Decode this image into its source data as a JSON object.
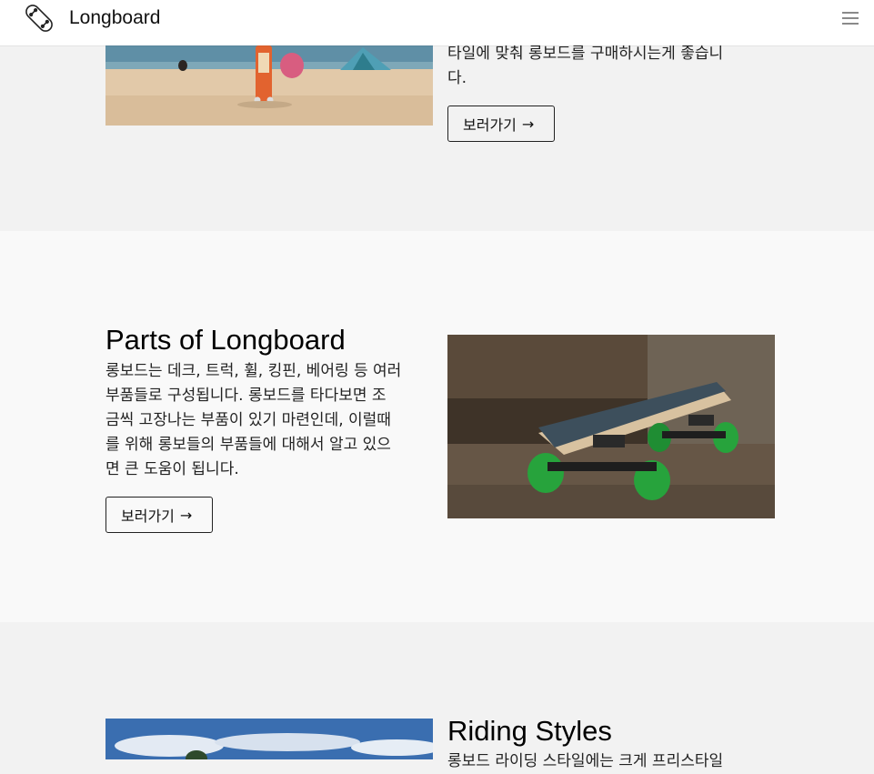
{
  "navbar": {
    "brand": "Longboard",
    "brand_icon": "skateboard-icon",
    "menu_icon": "hamburger-menu-icon"
  },
  "sections": [
    {
      "id": "buying",
      "text": "타일에 맞춰 롱보드를 구매하시는게 좋습니\n다.",
      "button_label": "보러가기",
      "button_arrow": "→"
    },
    {
      "id": "parts",
      "title": "Parts of Longboard",
      "text": "롱보드는 데크, 트럭, 휠, 킹핀, 베어링 등 여러\n부품들로 구성됩니다. 롱보드를 타다보면 조\n금씩 고장나는 부품이 있기 마련인데, 이럴때\n를 위해 롱보들의 부품들에 대해서 알고 있으\n면 큰 도움이 됩니다.",
      "button_label": "보러가기",
      "button_arrow": "→"
    },
    {
      "id": "riding",
      "title": "Riding Styles",
      "text": "롱보드 라이딩 스타일에는 크게 프리스타일"
    }
  ],
  "colors": {
    "navbar_bg": "#ffffff",
    "section_alt_bg": "#f2f2f2",
    "section_bg": "#f9f9f9",
    "text": "#222222",
    "button_border": "#222222"
  }
}
